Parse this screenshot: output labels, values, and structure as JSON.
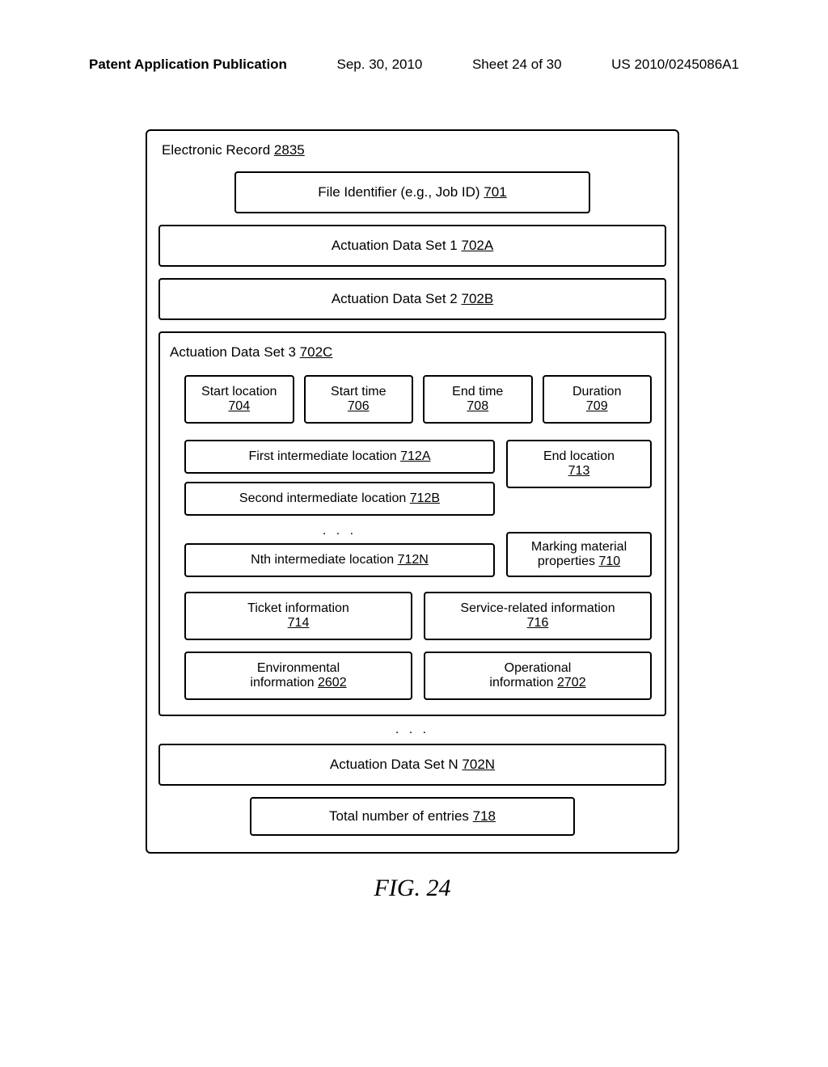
{
  "header": {
    "left": "Patent Application Publication",
    "date": "Sep. 30, 2010",
    "sheet": "Sheet 24 of 30",
    "pubno": "US 2010/0245086A1"
  },
  "record": {
    "title_text": "Electronic Record",
    "title_ref": "2835",
    "file_id_text": "File Identifier (e.g., Job ID)",
    "file_id_ref": "701",
    "ads1_text": "Actuation Data Set 1",
    "ads1_ref": "702A",
    "ads2_text": "Actuation Data Set 2",
    "ads2_ref": "702B",
    "ads3_title_text": "Actuation Data Set 3",
    "ads3_title_ref": "702C",
    "start_loc_text": "Start location",
    "start_loc_ref": "704",
    "start_time_text": "Start time",
    "start_time_ref": "706",
    "end_time_text": "End time",
    "end_time_ref": "708",
    "duration_text": "Duration",
    "duration_ref": "709",
    "first_int_text": "First intermediate location",
    "first_int_ref": "712A",
    "second_int_text": "Second intermediate location",
    "second_int_ref": "712B",
    "nth_int_text": "Nth intermediate location",
    "nth_int_ref": "712N",
    "end_loc_text": "End location",
    "end_loc_ref": "713",
    "marking_text": "Marking material properties",
    "marking_ref": "710",
    "ticket_text": "Ticket information",
    "ticket_ref": "714",
    "service_text": "Service-related information",
    "service_ref": "716",
    "env_text": "Environmental information",
    "env_ref": "2602",
    "op_text": "Operational information",
    "op_ref": "2702",
    "adsN_text": "Actuation Data Set N",
    "adsN_ref": "702N",
    "total_text": "Total number of entries",
    "total_ref": "718",
    "ellipsis": ". . ."
  },
  "figure_label": "FIG. 24"
}
